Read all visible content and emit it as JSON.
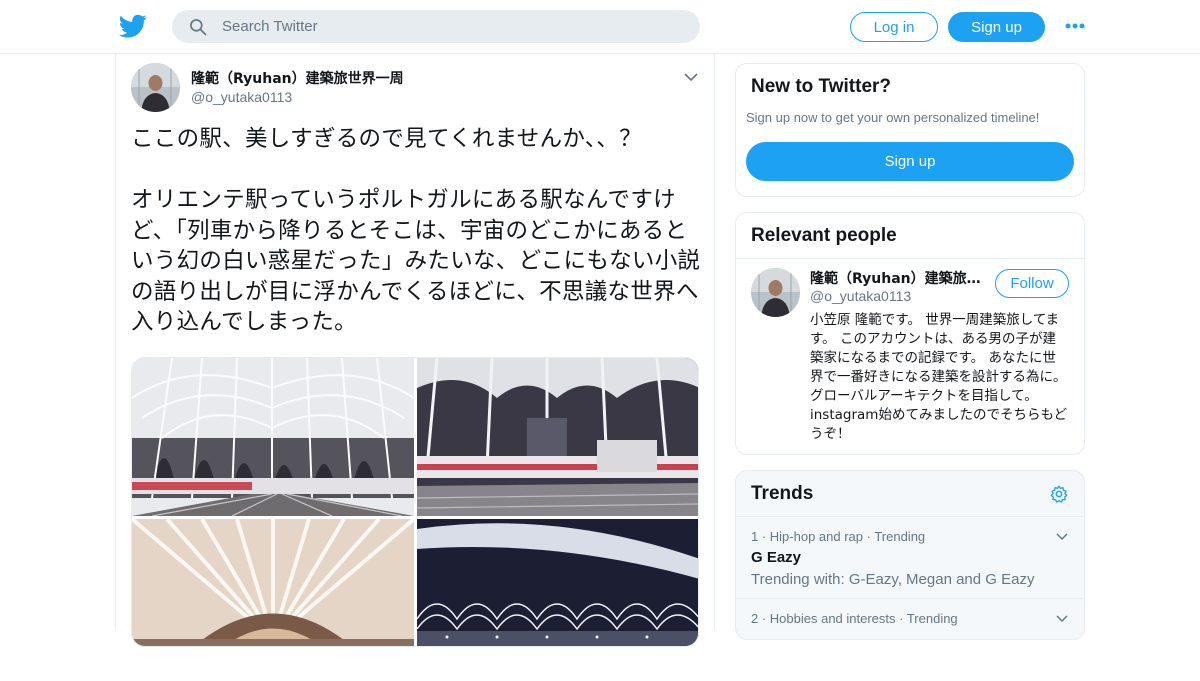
{
  "header": {
    "search_placeholder": "Search Twitter",
    "login_label": "Log in",
    "signup_label": "Sign up",
    "logo_icon": "twitter-bird-icon",
    "more_icon": "more-dots-icon"
  },
  "tweet": {
    "display_name": "隆範（Ryuhan）建築旅世界一周",
    "handle": "@o_yutaka0113",
    "text": "ここの駅、美しすぎるので見てくれませんか、、？\n\nオリエンテ駅っていうポルトガルにある駅なんですけど、「列車から降りるとそこは、宇宙のどこかにあるという幻の白い惑星だった」みたいな、どこにもない小説の語り出しが目に浮かんでくるほどに、不思議な世界へ入り込んでしまった。",
    "photo_count": 4
  },
  "new_to_twitter": {
    "title": "New to Twitter?",
    "subtitle": "Sign up now to get your own personalized timeline!",
    "signup_label": "Sign up"
  },
  "relevant_people": {
    "title": "Relevant people",
    "person": {
      "display_name": "隆範（Ryuhan）建築旅世界一周",
      "handle": "@o_yutaka0113",
      "follow_label": "Follow",
      "bio": "小笠原 隆範です。 世界一周建築旅してます。 このアカウントは、ある男の子が建築家になるまでの記録です。 あなたに世界で一番好きになる建築を設計する為に。 グローバルアーキテクトを目指して。 instagram始めてみましたのでそちらもどうぞ！"
    }
  },
  "trends": {
    "title": "Trends",
    "items": [
      {
        "meta": "1 · Hip-hop and rap · Trending",
        "name": "G Eazy",
        "with": "Trending with: G-Eazy, Megan and G Eazy"
      },
      {
        "meta": "2 · Hobbies and interests · Trending",
        "name": "",
        "with": ""
      }
    ]
  },
  "colors": {
    "brand": "#1da1f2",
    "text_primary": "#14171a",
    "text_secondary": "#657786",
    "border": "#e6ecf0"
  }
}
